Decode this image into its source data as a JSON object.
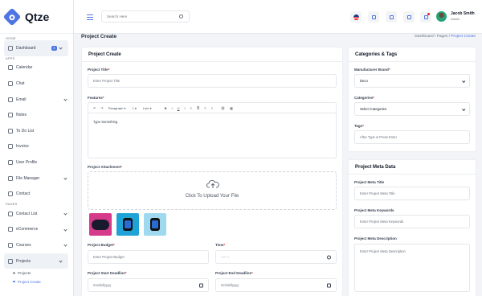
{
  "app": {
    "name": "Qtze"
  },
  "sidebar": {
    "sections": {
      "home": "HOME",
      "apps": "APPS",
      "pages": "PAGES"
    },
    "dashboard": {
      "label": "Dashboard",
      "badge": "5"
    },
    "apps": [
      "Calendar",
      "Chat",
      "Email",
      "Notes",
      "To Do List",
      "Invoice",
      "User Profile",
      "File Manager",
      "Contact"
    ],
    "pages": [
      "Contact List",
      "eCommerce",
      "Courses",
      "Projects"
    ],
    "projects_sub": [
      "Projects",
      "Project Create"
    ]
  },
  "header": {
    "search_placeholder": "Search Here",
    "user_name": "Jacob Smith",
    "user_role": "Admin"
  },
  "page": {
    "title": "Project Create",
    "breadcrumb": [
      "Dashboard",
      "Pages",
      "Project Create"
    ],
    "breadcrumb_sep": "/"
  },
  "project_card": {
    "title": "Project Create",
    "project_title": {
      "label": "Project Title",
      "placeholder": "Enter Project Title"
    },
    "features": {
      "label": "Features",
      "toolbar": [
        "↶",
        "↷",
        "Paragraph",
        "▾",
        "1",
        "▾",
        "Line",
        "▾",
        "B",
        "I",
        "U",
        "I",
        "≡",
        "≣",
        "≡",
        "≡",
        "⛓",
        "▦"
      ],
      "content": "Type Something"
    },
    "attachment": {
      "label": "Project Attachment",
      "upload_text": "Click To Upload Your File"
    },
    "budget": {
      "label": "Project Budget",
      "placeholder": "Enter Project Budget"
    },
    "time": {
      "label": "Time",
      "value": "--:-- --"
    },
    "start_deadline": {
      "label": "Project Start Deadline",
      "value": "mm/dd/yyyy"
    },
    "end_deadline": {
      "label": "Project End Deadline",
      "value": "mm/dd/yyyy"
    }
  },
  "categories_card": {
    "title": "Categories & Tags",
    "manufacturer": {
      "label": "Manufacturer Brand",
      "value": "Deco"
    },
    "category": {
      "label": "Categories",
      "value": "Select Categories"
    },
    "tags": {
      "label": "Tags",
      "placeholder": "After Type & Press Enter"
    }
  },
  "meta_card": {
    "title": "Project Meta Data",
    "meta_title": {
      "label": "Project Meta Title",
      "placeholder": "Enter Project Meta Title"
    },
    "meta_keywords": {
      "label": "Project Meta Keywords",
      "placeholder": "Enter Project Meta Keywords"
    },
    "meta_description": {
      "label": "Project Meta Description",
      "placeholder": "Enter Project Meta Description"
    }
  },
  "colors": {
    "accent": "#4f74e3",
    "required": "#dc2626"
  }
}
